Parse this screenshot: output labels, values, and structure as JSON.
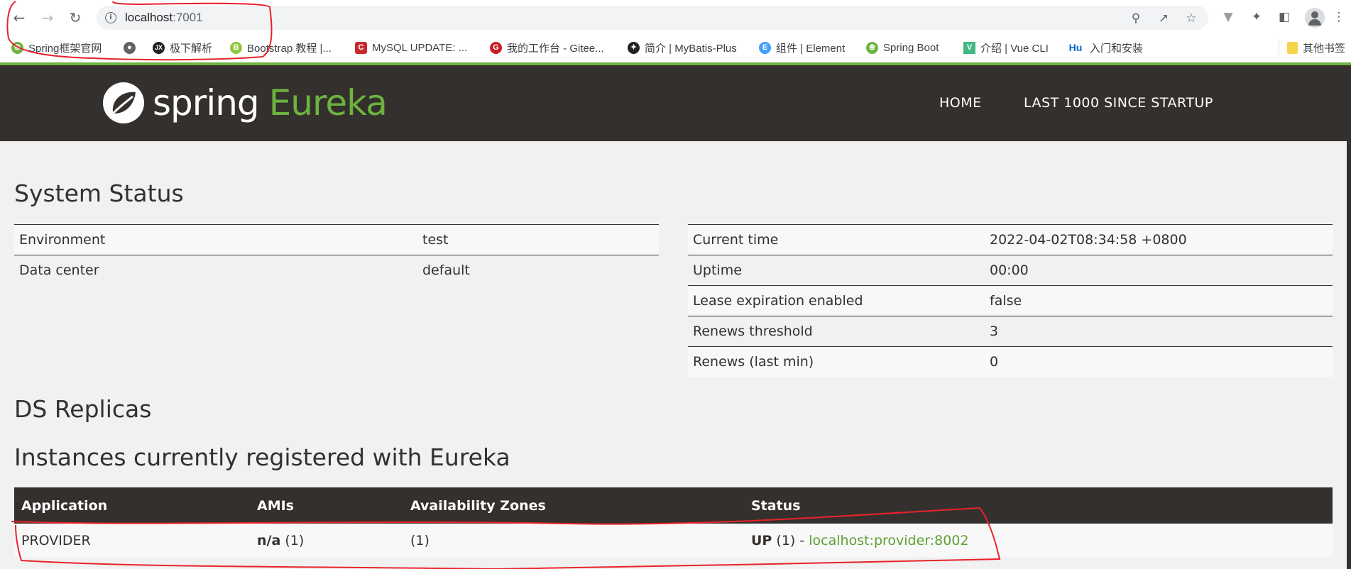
{
  "browser": {
    "url_host": "localhost",
    "url_port": ":7001",
    "bookmarks": [
      {
        "label": "Spring框架官网",
        "icon": "spring-leaf-icon",
        "color": "#6db33f"
      },
      {
        "label": "",
        "icon": "globe-icon",
        "color": "#5f6368"
      },
      {
        "label": "极下解析",
        "icon": "jx-logo-icon",
        "color": "#202124"
      },
      {
        "label": "Bootstrap 教程 |...",
        "icon": "bootstrap-icon",
        "color": "#8fc73e"
      },
      {
        "label": "MySQL UPDATE: ...",
        "icon": "c-logo-icon",
        "color": "#c9282d"
      },
      {
        "label": "我的工作台 - Gitee...",
        "icon": "gitee-icon",
        "color": "#c71d23"
      },
      {
        "label": "简介 | MyBatis-Plus",
        "icon": "bird-icon",
        "color": "#202124"
      },
      {
        "label": "组件 | Element",
        "icon": "element-icon",
        "color": "#409eff"
      },
      {
        "label": "Spring Boot",
        "icon": "spring-leaf-icon",
        "color": "#6db33f"
      },
      {
        "label": "介绍 | Vue CLI",
        "icon": "vue-icon",
        "color": "#41b883"
      },
      {
        "label": "入门和安装",
        "icon": "hu-logo-icon",
        "color": "#0066cc"
      }
    ],
    "other_bookmarks": "其他书签"
  },
  "nav": {
    "brand_spring": "spring",
    "brand_eureka": "Eureka",
    "home": "HOME",
    "last1000": "LAST 1000 SINCE STARTUP"
  },
  "system_status": {
    "title": "System Status",
    "left": [
      {
        "key": "Environment",
        "value": "test"
      },
      {
        "key": "Data center",
        "value": "default"
      }
    ],
    "right": [
      {
        "key": "Current time",
        "value": "2022-04-02T08:34:58 +0800"
      },
      {
        "key": "Uptime",
        "value": "00:00"
      },
      {
        "key": "Lease expiration enabled",
        "value": "false"
      },
      {
        "key": "Renews threshold",
        "value": "3"
      },
      {
        "key": "Renews (last min)",
        "value": "0"
      }
    ]
  },
  "ds_replicas": {
    "title": "DS Replicas"
  },
  "instances": {
    "title": "Instances currently registered with Eureka",
    "headers": [
      "Application",
      "AMIs",
      "Availability Zones",
      "Status"
    ],
    "rows": [
      {
        "application": "PROVIDER",
        "ami_bold": "n/a",
        "ami_count": "(1)",
        "zones": "(1)",
        "status_bold": "UP",
        "status_count": "(1) -",
        "instance_link": "localhost:provider:8002"
      }
    ]
  },
  "colors": {
    "brand_green": "#6db33f",
    "navbar_bg": "#34302d",
    "annotation_red": "#e8232a"
  }
}
